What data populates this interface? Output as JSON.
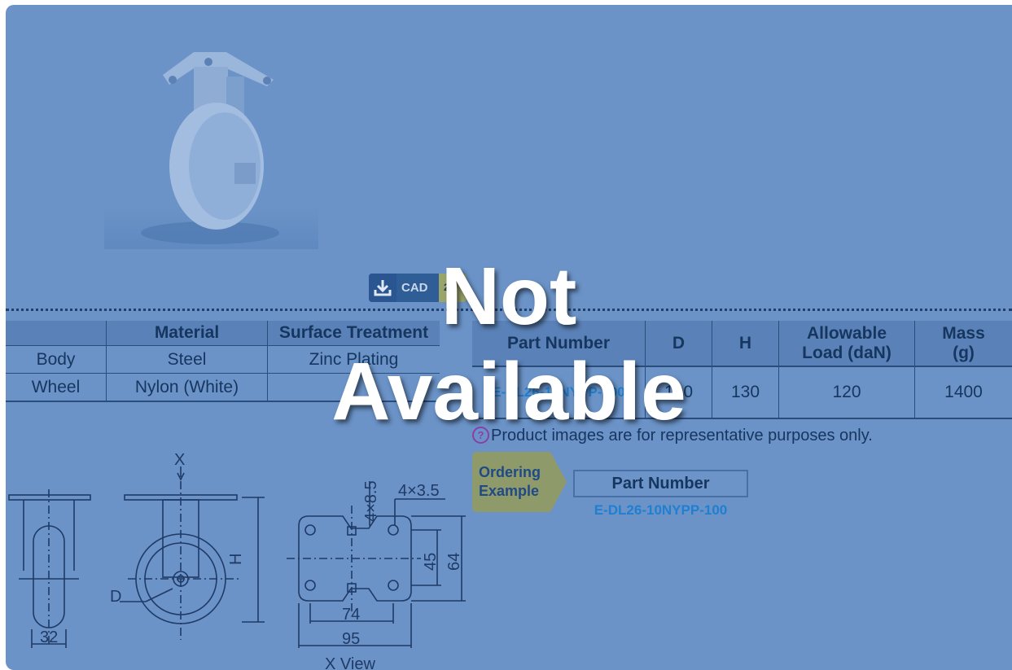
{
  "cad_badge": {
    "label": "CAD",
    "format": "2D",
    "icon": "download-icon"
  },
  "material_table": {
    "headers": [
      "",
      "Material",
      "Surface Treatment"
    ],
    "rows": [
      [
        "Body",
        "Steel",
        "Zinc Plating"
      ],
      [
        "Wheel",
        "Nylon (White)",
        ""
      ]
    ]
  },
  "part_table": {
    "headers": [
      "Part Number",
      "D",
      "H",
      "Allowable Load (daN)",
      "Mass (g)"
    ],
    "header_lines": {
      "load": [
        "Allowable",
        "Load (daN)"
      ],
      "mass": [
        "Mass",
        "(g)"
      ]
    },
    "row": {
      "part_number": "E-DL26-10NYPP-100",
      "d": "100",
      "h": "130",
      "load": "120",
      "mass": "1400"
    }
  },
  "note": "Product images are for representative purposes only.",
  "ordering": {
    "title_lines": [
      "Ordering",
      "Example"
    ],
    "box_label": "Part Number",
    "example": "E-DL26-10NYPP-100"
  },
  "drawing_labels": {
    "x": "X",
    "h": "H",
    "d": "D",
    "w32": "32",
    "slot": "4×8.5",
    "hole": "4×3.5",
    "h45": "45",
    "h64": "64",
    "w74": "74",
    "w95": "95",
    "view": "X View"
  },
  "overlay": {
    "line1": "Not",
    "line2": "Available"
  },
  "colors": {
    "background": "#6b93c7",
    "accent_link": "#1f7fd0",
    "ordering_badge": "#8f9a6a"
  }
}
